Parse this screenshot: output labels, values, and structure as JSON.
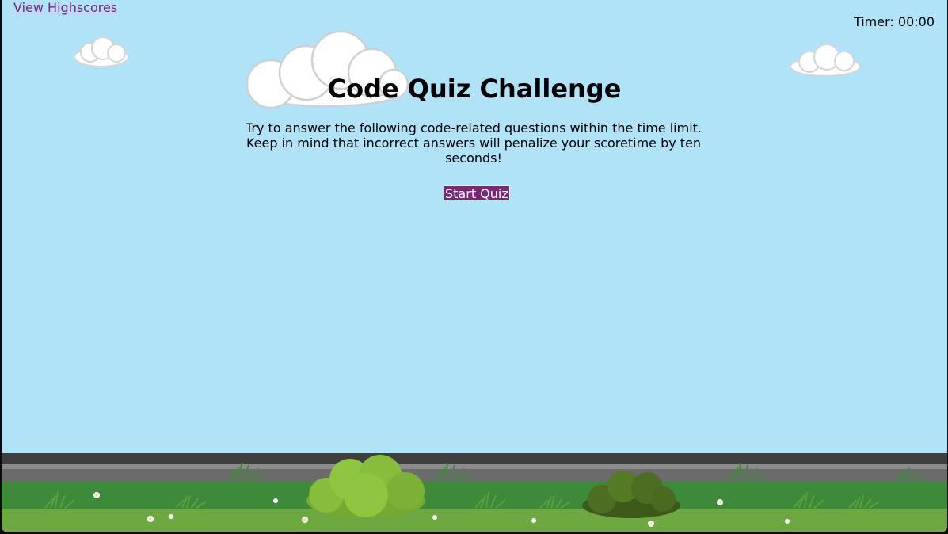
{
  "header": {
    "highscores_link": "View Highscores",
    "timer_label": "Timer:",
    "timer_value": "00:00"
  },
  "main": {
    "title": "Code Quiz Challenge",
    "instructions": "Try to answer the following code-related questions within the time limit. Keep in mind that incorrect answers will penalize your scoretime by ten seconds!",
    "start_button": "Start Quiz"
  },
  "colors": {
    "sky": "#b0e2f8",
    "link": "#7b1f7c",
    "button": "#7a2679",
    "road_dark": "#3f3f3f",
    "road_light": "#6b6b6b",
    "grass_dark": "#3c8a3a",
    "grass_light": "#6ea843",
    "bush_light": "#87bd3c",
    "bush_dark": "#4d6d22"
  },
  "scenery": {
    "icons": [
      "cloud-icon",
      "bush-icon",
      "grass-tuft-icon",
      "flower-icon"
    ]
  }
}
